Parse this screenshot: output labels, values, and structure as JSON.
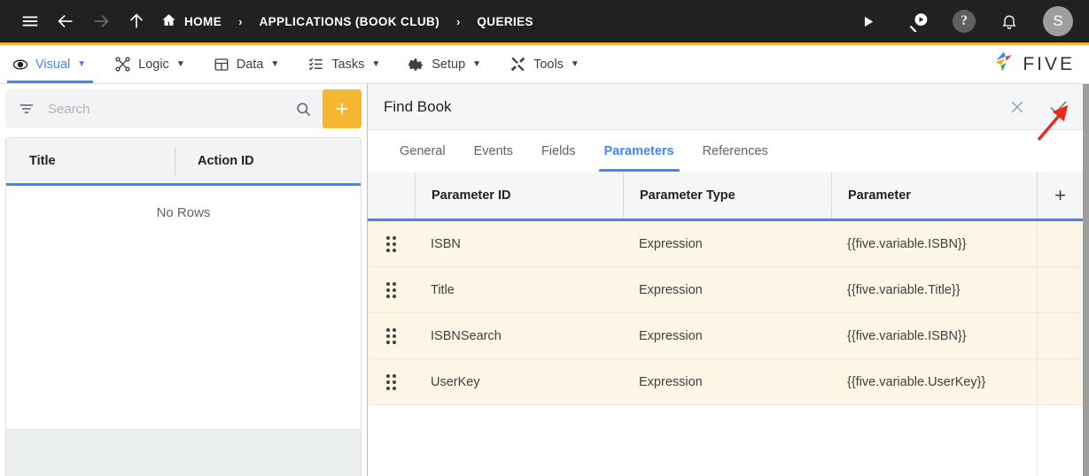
{
  "topbar": {
    "icons": {
      "menu": "hamburger-menu-icon",
      "back": "back-arrow-icon",
      "forward": "forward-arrow-icon",
      "up": "up-arrow-icon",
      "home": "home-icon",
      "run": "play-icon",
      "search_run": "search-play-icon",
      "help": "help-icon",
      "notifications": "bell-icon"
    },
    "help_glyph": "?",
    "breadcrumbs": [
      {
        "label": "HOME",
        "icon": "home-icon"
      },
      {
        "label": "APPLICATIONS (BOOK CLUB)"
      },
      {
        "label": "QUERIES"
      }
    ],
    "separator": "›",
    "avatar_initial": "S"
  },
  "menubar": {
    "items": [
      {
        "label": "Visual",
        "icon": "eye-icon",
        "active": true
      },
      {
        "label": "Logic",
        "icon": "logic-nodes-icon",
        "active": false
      },
      {
        "label": "Data",
        "icon": "table-grid-icon",
        "active": false
      },
      {
        "label": "Tasks",
        "icon": "task-list-icon",
        "active": false
      },
      {
        "label": "Setup",
        "icon": "gear-icon",
        "active": false
      },
      {
        "label": "Tools",
        "icon": "tools-icon",
        "active": false
      }
    ],
    "caret": "▼",
    "logo_text": "FIVE",
    "accent_top": "#f5b731",
    "active_color": "#4285f4"
  },
  "left_panel": {
    "search": {
      "placeholder": "Search",
      "value": "",
      "filter_icon": "filter-icon",
      "search_icon": "search-icon"
    },
    "add_button_label": "+",
    "add_button_color": "#f5b731",
    "table": {
      "columns": [
        "Title",
        "Action ID"
      ],
      "rows": [],
      "empty_message": "No Rows"
    }
  },
  "right_panel": {
    "title": "Find Book",
    "actions": {
      "close_icon": "close-icon",
      "confirm_icon": "check-icon"
    },
    "tabs": [
      {
        "label": "General",
        "active": false
      },
      {
        "label": "Events",
        "active": false
      },
      {
        "label": "Fields",
        "active": false
      },
      {
        "label": "Parameters",
        "active": true
      },
      {
        "label": "References",
        "active": false
      }
    ],
    "grid": {
      "columns": [
        "Parameter ID",
        "Parameter Type",
        "Parameter"
      ],
      "add_label": "+",
      "row_background": "#fdf6e6",
      "rows": [
        {
          "drag": "drag-handle-icon",
          "parameter_id": "ISBN",
          "parameter_type": "Expression",
          "parameter": "{{five.variable.ISBN}}"
        },
        {
          "drag": "drag-handle-icon",
          "parameter_id": "Title",
          "parameter_type": "Expression",
          "parameter": "{{five.variable.Title}}"
        },
        {
          "drag": "drag-handle-icon",
          "parameter_id": "ISBNSearch",
          "parameter_type": "Expression",
          "parameter": "{{five.variable.ISBN}}"
        },
        {
          "drag": "drag-handle-icon",
          "parameter_id": "UserKey",
          "parameter_type": "Expression",
          "parameter": "{{five.variable.UserKey}}"
        }
      ]
    }
  },
  "annotation": {
    "arrow_color": "#e8291c",
    "points_to": "confirm-check-button"
  }
}
